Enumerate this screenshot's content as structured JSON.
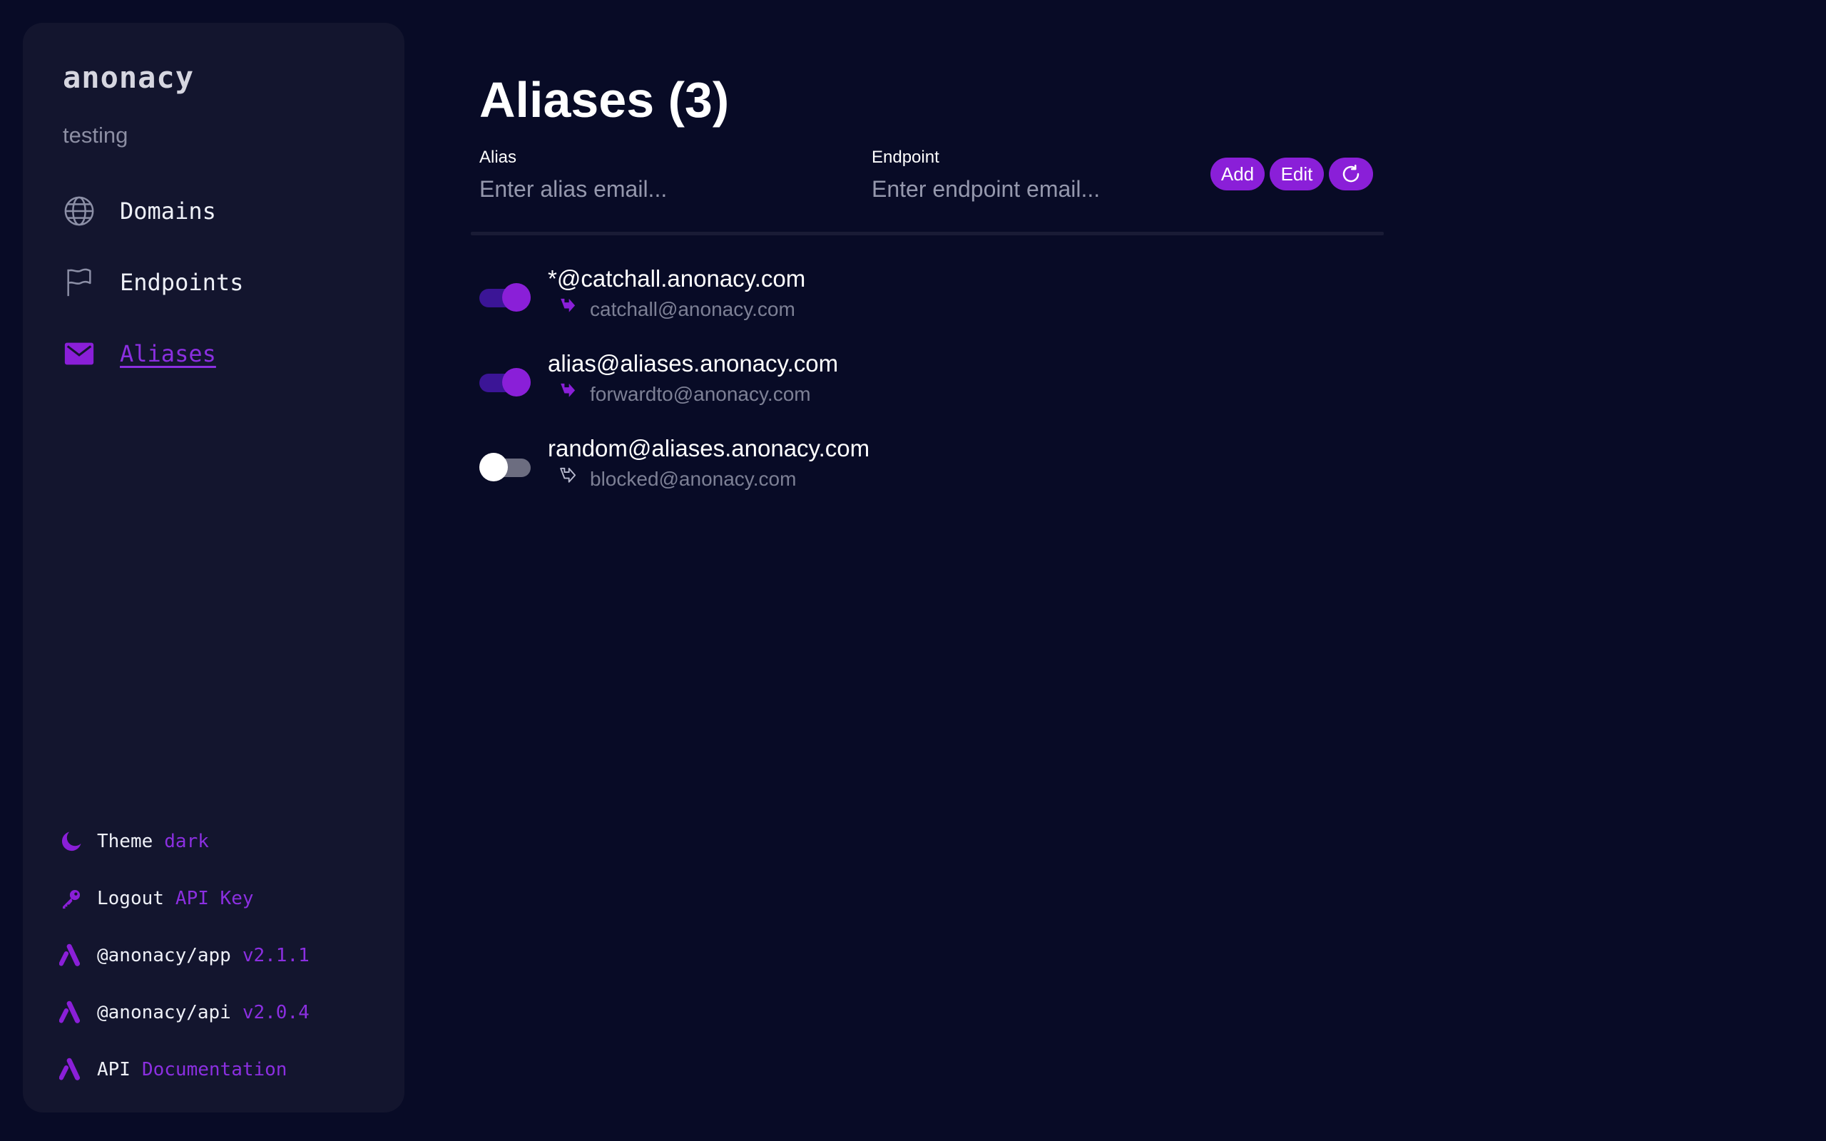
{
  "sidebar": {
    "brand": "anonacy",
    "subtitle": "testing",
    "nav": [
      {
        "label": "Domains",
        "icon": "globe-icon",
        "active": false
      },
      {
        "label": "Endpoints",
        "icon": "flag-icon",
        "active": false
      },
      {
        "label": "Aliases",
        "icon": "mail-icon",
        "active": true
      }
    ],
    "footer": [
      {
        "icon": "moon-icon",
        "label": "Theme",
        "value": "dark"
      },
      {
        "icon": "key-icon",
        "label": "Logout",
        "value": "API Key"
      },
      {
        "icon": "anonacy-logo-icon",
        "label": "@anonacy/app",
        "value": "v2.1.1"
      },
      {
        "icon": "anonacy-logo-icon",
        "label": "@anonacy/api",
        "value": "v2.0.4"
      },
      {
        "icon": "anonacy-logo-icon",
        "label": "API",
        "value": "Documentation"
      }
    ]
  },
  "main": {
    "title": "Aliases (3)",
    "form": {
      "alias_label": "Alias",
      "alias_placeholder": "Enter alias email...",
      "alias_value": "",
      "endpoint_label": "Endpoint",
      "endpoint_placeholder": "Enter endpoint email...",
      "endpoint_value": "",
      "add_label": "Add",
      "edit_label": "Edit",
      "refresh_icon": "refresh-icon"
    },
    "aliases": [
      {
        "alias": "*@catchall.anonacy.com",
        "endpoint": "catchall@anonacy.com",
        "enabled": true
      },
      {
        "alias": "alias@aliases.anonacy.com",
        "endpoint": "forwardto@anonacy.com",
        "enabled": true
      },
      {
        "alias": "random@aliases.anonacy.com",
        "endpoint": "blocked@anonacy.com",
        "enabled": false
      }
    ]
  },
  "colors": {
    "background": "#080b26",
    "sidebar": "#13152e",
    "accent": "#8a1fd8",
    "accent_text": "#8b2fe0",
    "muted_text": "#7d8095"
  }
}
